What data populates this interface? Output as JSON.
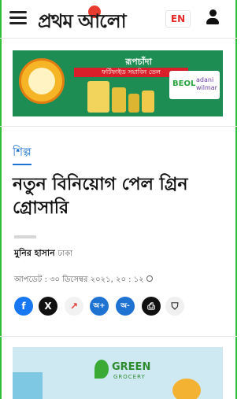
{
  "header": {
    "logo_text": "প্রথম আলো",
    "lang_label": "EN"
  },
  "ad_top": {
    "brand": "রূপচাঁদা",
    "subtitle": "ফর্টিফাইড সয়াবিন তেল",
    "partner1": "BEOL",
    "partner2": "adani wilmar"
  },
  "article": {
    "category": "শিল্প",
    "headline": "নতুন বিনিয়োগ পেল গ্রিন গ্রোসারি",
    "author": "মুনির হাসান",
    "author_location": "ঢাকা",
    "updated": "আপডেট : ৩০ ডিসেম্বর ২০২১, ২০ : ১২"
  },
  "social": {
    "share_icons": [
      "f",
      "X",
      "↗",
      "অ+",
      "অ-",
      "⎙",
      "⛉"
    ]
  },
  "ad_bottom": {
    "brand": "GREEN",
    "sub": "GROCERY"
  },
  "colors": {
    "accent": "#1e72d2",
    "logo_sun": "#e63b2e",
    "frame": "#2fbf3a"
  }
}
